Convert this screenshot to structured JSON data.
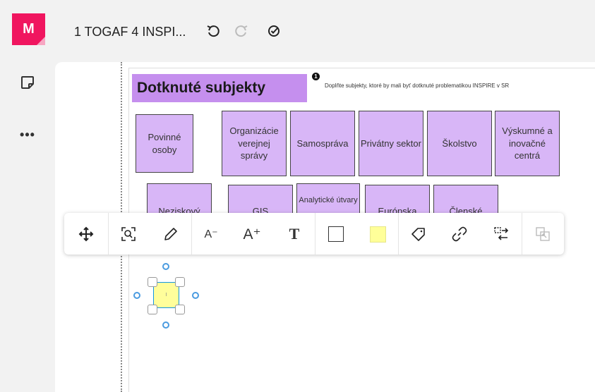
{
  "logo": {
    "letter": "M",
    "brand_color": "#f0155f"
  },
  "sidebar": {
    "items": [
      {
        "icon": "sticky-note-icon"
      },
      {
        "icon": "more-icon",
        "label": "•••"
      }
    ]
  },
  "header": {
    "board_title": "1 TOGAF 4 INSPI...",
    "icons": [
      "undo-icon",
      "redo-icon",
      "check-circle-icon"
    ]
  },
  "board": {
    "title_note": {
      "text": "Dotknuté subjekty",
      "color": "#c58fee"
    },
    "badge": "1",
    "instruction": "Doplňte subjekty, ktoré by mali byť dotknuté problematikou INSPIRE v SR",
    "note_color": "#d8b6f7",
    "notes_row1": [
      "Povinné osoby",
      "Organizácie verejnej správy",
      "Samospráva",
      "Privátny sektor",
      "Školstvo",
      "Výskumné a inovačné centrá"
    ],
    "notes_row2": [
      "Neziskový",
      "GIS",
      "Analytické útvary",
      "Európska",
      "Členské"
    ]
  },
  "toolbar": {
    "items": [
      "move-icon",
      "zoom-to-fit-icon",
      "pencil-icon",
      "decrease-font-icon",
      "increase-font-icon",
      "text-format-icon",
      "border-icon",
      "fill-color-swatch",
      "tag-icon",
      "link-icon",
      "swap-icon",
      "send-to-frame-icon"
    ],
    "font_small": "A⁻",
    "font_large": "A⁺",
    "text_glyph": "T",
    "fill_color": "#ffff99"
  },
  "selected_note": {
    "text": "I",
    "color": "#fffe9b"
  }
}
